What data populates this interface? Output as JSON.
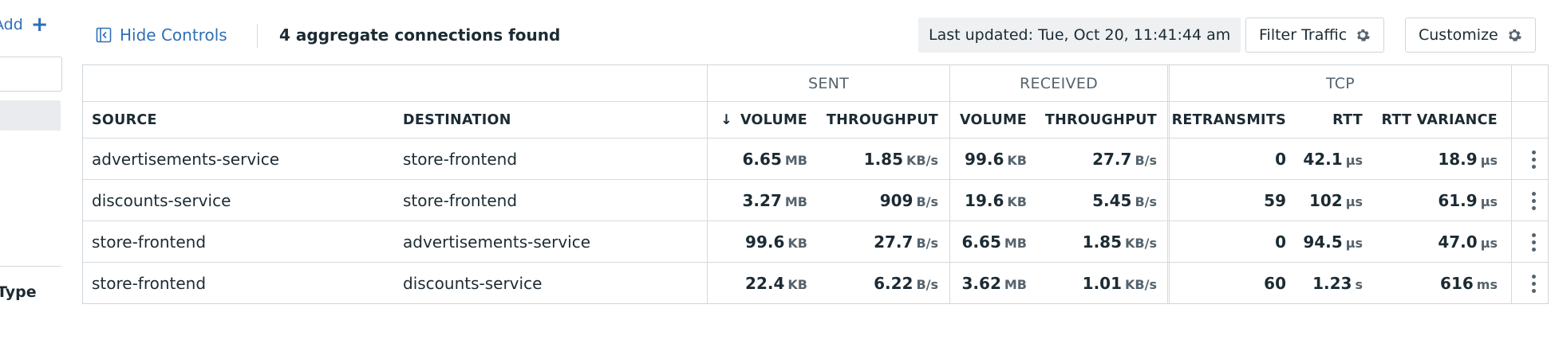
{
  "sidebar": {
    "add_label": "Add",
    "add_icon": "plus-icon",
    "type_label": "Type"
  },
  "toolbar": {
    "hide_controls": "Hide Controls",
    "connections_found": "4 aggregate connections found",
    "last_updated": "Last updated: Tue, Oct 20, 11:41:44 am",
    "filter_traffic": "Filter Traffic",
    "customize": "Customize"
  },
  "table": {
    "groups": {
      "sent": "SENT",
      "received": "RECEIVED",
      "tcp": "TCP"
    },
    "columns": {
      "source": "SOURCE",
      "destination": "DESTINATION",
      "sent_volume": "VOLUME",
      "sent_throughput": "THROUGHPUT",
      "recv_volume": "VOLUME",
      "recv_throughput": "THROUGHPUT",
      "retransmits": "RETRANSMITS",
      "rtt": "RTT",
      "rtt_variance": "RTT VARIANCE"
    },
    "sort_indicator": "↓",
    "rows": [
      {
        "source": "advertisements-service",
        "destination": "store-frontend",
        "sent_volume": "6.65",
        "sent_volume_unit": "MB",
        "sent_throughput": "1.85",
        "sent_throughput_unit": "KB/s",
        "recv_volume": "99.6",
        "recv_volume_unit": "KB",
        "recv_throughput": "27.7",
        "recv_throughput_unit": "B/s",
        "retransmits": "0",
        "rtt": "42.1",
        "rtt_unit": "µs",
        "rtt_variance": "18.9",
        "rtt_variance_unit": "µs"
      },
      {
        "source": "discounts-service",
        "destination": "store-frontend",
        "sent_volume": "3.27",
        "sent_volume_unit": "MB",
        "sent_throughput": "909",
        "sent_throughput_unit": "B/s",
        "recv_volume": "19.6",
        "recv_volume_unit": "KB",
        "recv_throughput": "5.45",
        "recv_throughput_unit": "B/s",
        "retransmits": "59",
        "rtt": "102",
        "rtt_unit": "µs",
        "rtt_variance": "61.9",
        "rtt_variance_unit": "µs"
      },
      {
        "source": "store-frontend",
        "destination": "advertisements-service",
        "sent_volume": "99.6",
        "sent_volume_unit": "KB",
        "sent_throughput": "27.7",
        "sent_throughput_unit": "B/s",
        "recv_volume": "6.65",
        "recv_volume_unit": "MB",
        "recv_throughput": "1.85",
        "recv_throughput_unit": "KB/s",
        "retransmits": "0",
        "rtt": "94.5",
        "rtt_unit": "µs",
        "rtt_variance": "47.0",
        "rtt_variance_unit": "µs"
      },
      {
        "source": "store-frontend",
        "destination": "discounts-service",
        "sent_volume": "22.4",
        "sent_volume_unit": "KB",
        "sent_throughput": "6.22",
        "sent_throughput_unit": "B/s",
        "recv_volume": "3.62",
        "recv_volume_unit": "MB",
        "recv_throughput": "1.01",
        "recv_throughput_unit": "KB/s",
        "retransmits": "60",
        "rtt": "1.23",
        "rtt_unit": "s",
        "rtt_variance": "616",
        "rtt_variance_unit": "ms"
      }
    ]
  },
  "colors": {
    "link": "#2f6fb8",
    "text": "#1c2b33",
    "muted": "#55636d",
    "border": "#cfd5da"
  }
}
